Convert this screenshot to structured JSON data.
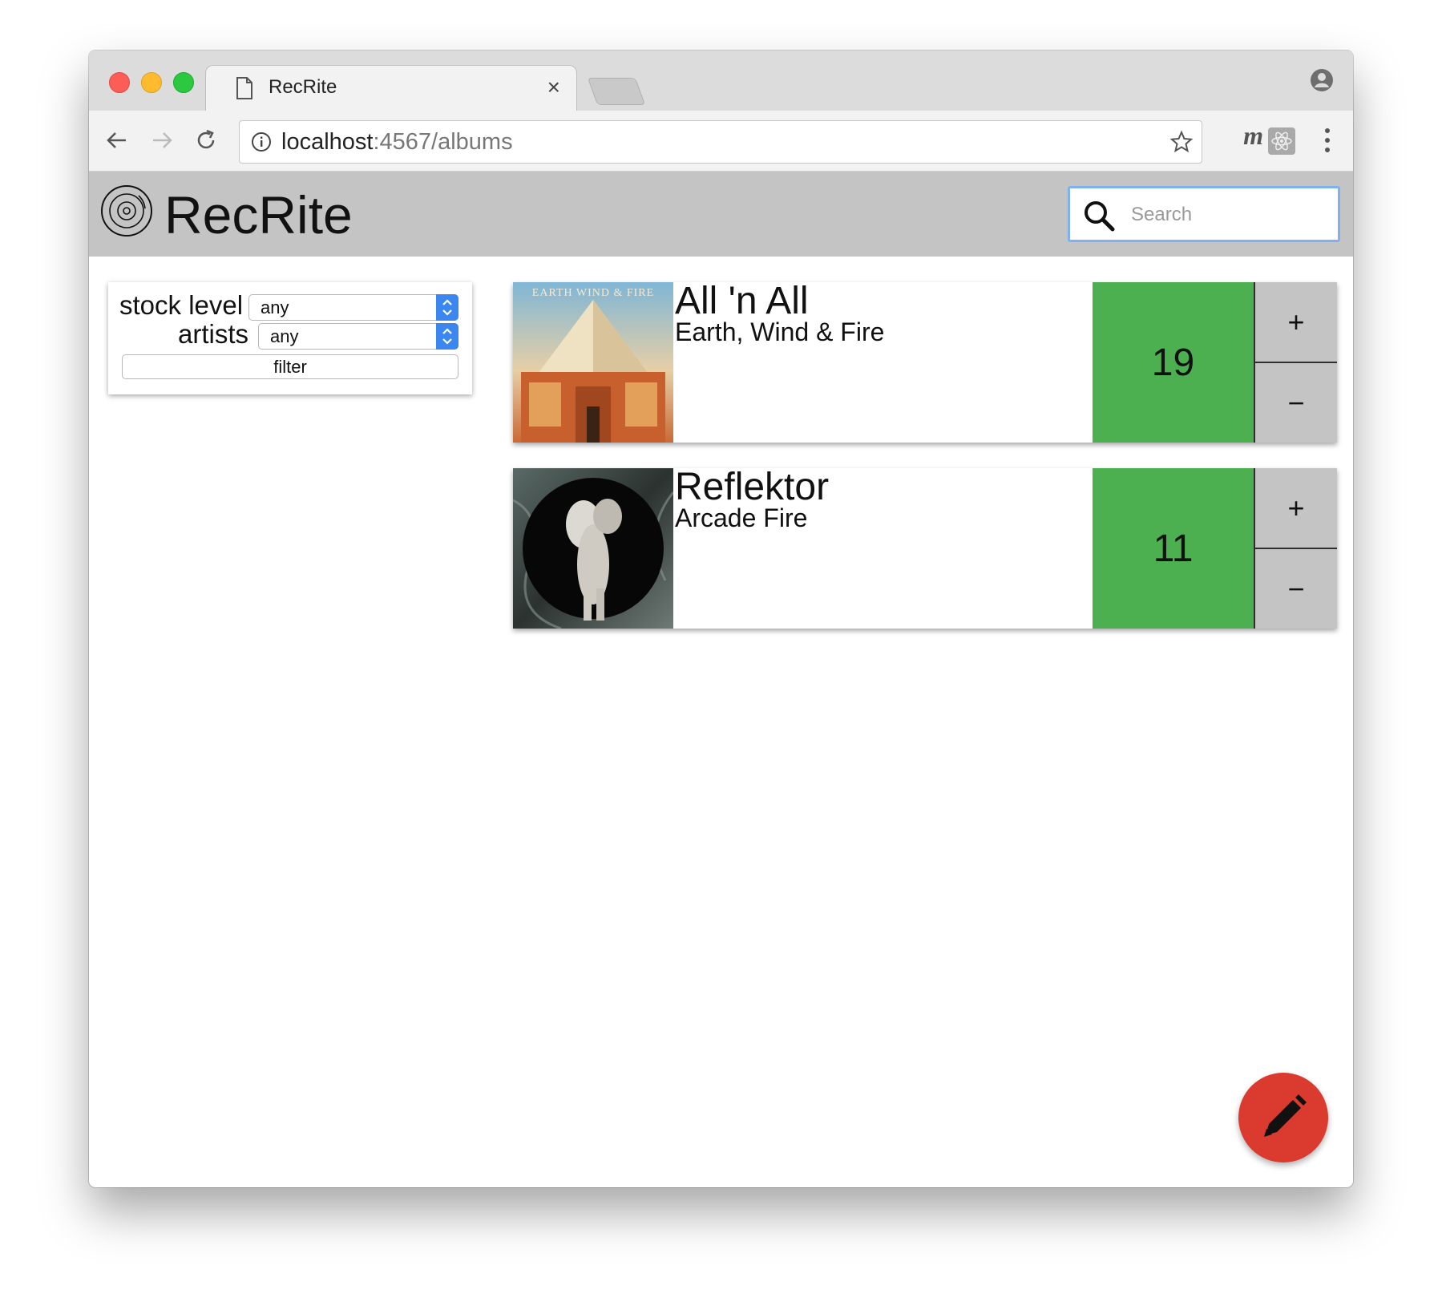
{
  "browser": {
    "tab_title": "RecRite",
    "tab_close": "×",
    "url_host": "localhost",
    "url_rest": ":4567/albums",
    "extension_m": "m"
  },
  "app": {
    "title": "RecRite",
    "search_placeholder": "Search"
  },
  "filters": {
    "stock_level_label": "stock level",
    "stock_level_value": "any",
    "artists_label": "artists",
    "artists_value": "any",
    "filter_button": "filter"
  },
  "albums": [
    {
      "title": "All 'n All",
      "artist": "Earth, Wind & Fire",
      "stock": "19",
      "cover_text": "EARTH WIND & FIRE"
    },
    {
      "title": "Reflektor",
      "artist": "Arcade Fire",
      "stock": "11"
    }
  ],
  "quantity_controls": {
    "increment": "+",
    "decrement": "−"
  },
  "colors": {
    "appbar": "#c4c4c4",
    "stock_fill": "#4caf50",
    "fab": "#db3a2e",
    "search_focus": "#7fb0f0"
  }
}
